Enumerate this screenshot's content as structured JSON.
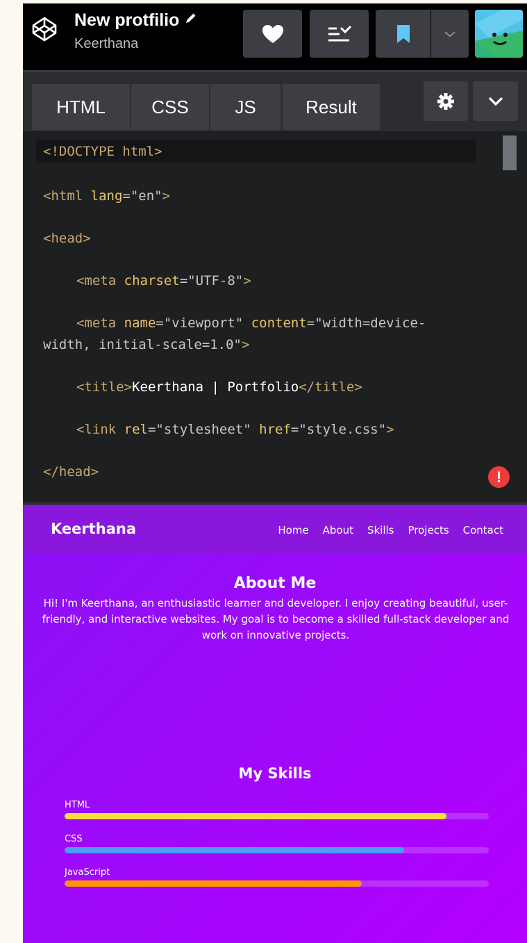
{
  "header": {
    "title": "New protfilio",
    "owner": "Keerthana",
    "buttons": {
      "heart": "heart-icon",
      "fork": "fork-icon",
      "save": "bookmark-icon",
      "drop": "chevron-down-icon"
    }
  },
  "editor": {
    "tabs": [
      "HTML",
      "CSS",
      "JS",
      "Result"
    ],
    "code": {
      "l1": "<!DOCTYPE html>",
      "l2_tag_open": "<html ",
      "l2_attr": "lang",
      "l2_val": "=\"en\"",
      "l2_close": ">",
      "l3": "<head>",
      "l4_tag": "<meta ",
      "l4_attr": "charset",
      "l4_val": "=\"UTF-8\"",
      "l4_close": ">",
      "l5_tag": "<meta ",
      "l5_attr1": "name",
      "l5_val1": "=\"viewport\" ",
      "l5_attr2": "content",
      "l5_val2a": "=\"width=device-",
      "l5_val2b": "width, initial-scale=1.0\"",
      "l5_close": ">",
      "l6_open": "<title>",
      "l6_text": "Keerthana | Portfolio",
      "l6_close": "</title>",
      "l7_tag": "<link ",
      "l7_attr1": "rel",
      "l7_val1": "=\"stylesheet\" ",
      "l7_attr2": "href",
      "l7_val2": "=\"style.css\"",
      "l7_close": ">",
      "l8": "</head>"
    },
    "error_mark": "!"
  },
  "result": {
    "brand": "Keerthana",
    "nav": [
      "Home",
      "About",
      "Skills",
      "Projects",
      "Contact"
    ],
    "about_title": "About Me",
    "about_text": "Hi! I'm Keerthana, an enthusiastic learner and developer. I enjoy creating beautiful, user-friendly, and interactive websites. My goal is to become a skilled full-stack developer and work on innovative projects.",
    "skills_title": "My Skills",
    "skills": [
      {
        "name": "HTML",
        "level": 0.9,
        "color": "#f5e03b"
      },
      {
        "name": "CSS",
        "level": 0.8,
        "color": "#4a9cf5"
      },
      {
        "name": "JavaScript",
        "level": 0.7,
        "color": "#ff9400"
      }
    ]
  }
}
